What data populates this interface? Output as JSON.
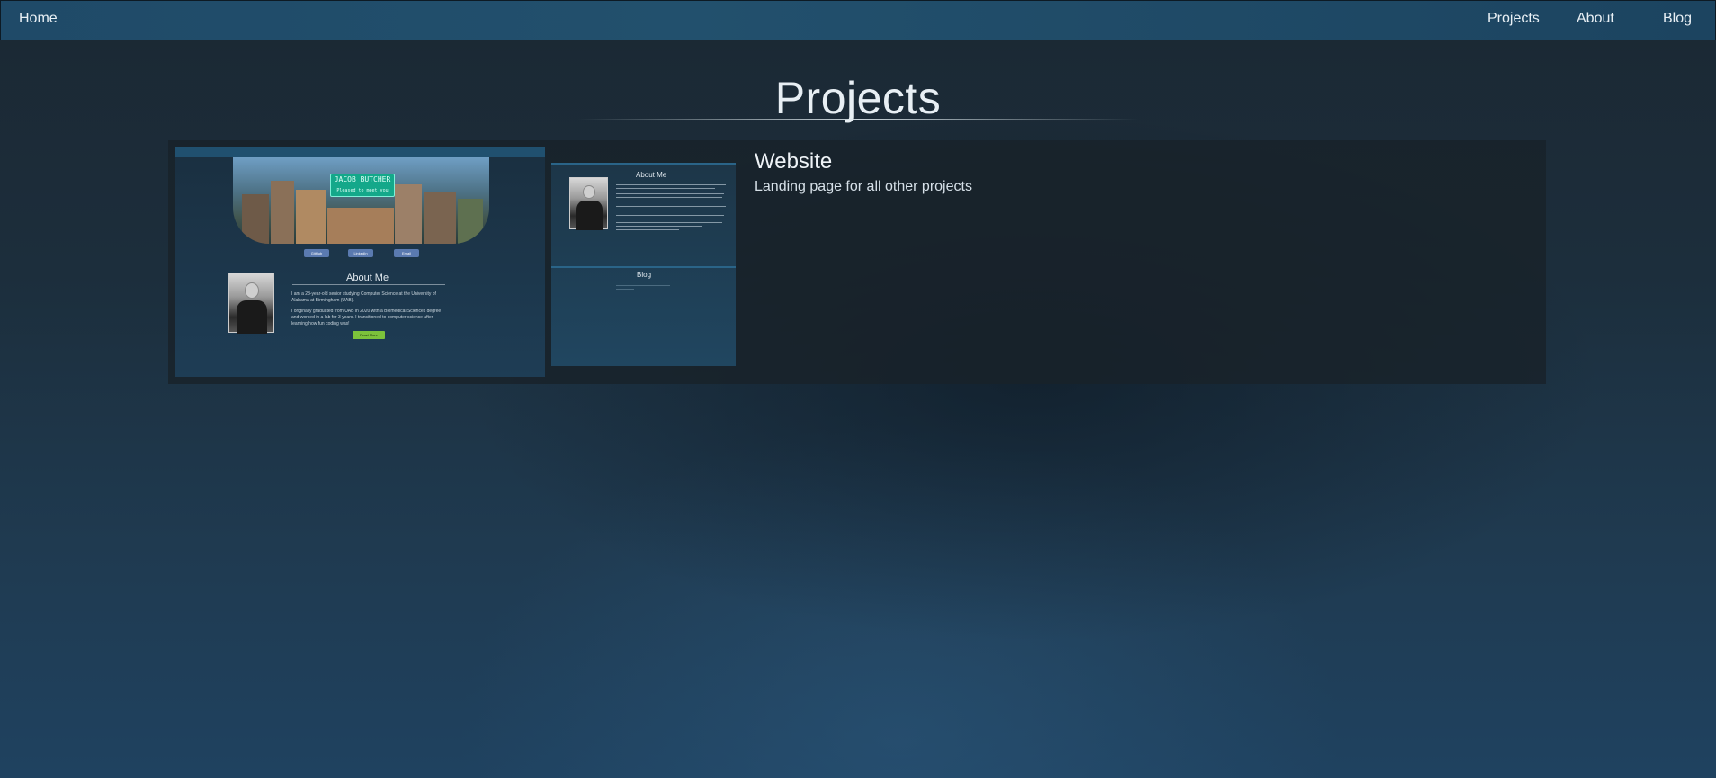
{
  "nav": {
    "home_label": "Home",
    "projects_label": "Projects",
    "about_label": "About",
    "blog_label": "Blog"
  },
  "page": {
    "title": "Projects"
  },
  "projects": [
    {
      "title": "Website",
      "description": "Landing page for all other projects",
      "preview_main": {
        "banner_text_line1": "JACOB BUTCHER",
        "banner_text_line2": "Pleased to meet you",
        "buttons": [
          "GitHub",
          "LinkedIn",
          "Email"
        ],
        "about_heading": "About Me",
        "about_paragraph_1": "I am a 28-year-old senior studying Computer Science at the University of Alabama at Birmingham (UAB).",
        "about_paragraph_2": "I originally graduated from UAB in 2020 with a Biomedical Sciences degree and worked in a lab for 3 years. I transitioned to computer science after learning how fun coding was!",
        "read_more_label": "Read More"
      },
      "preview_secondary": {
        "about_heading": "About Me",
        "blog_heading": "Blog"
      }
    }
  ],
  "colors": {
    "navbar": "#22506d",
    "card_background": "#18222a",
    "accent_green": "#7cc23b"
  }
}
